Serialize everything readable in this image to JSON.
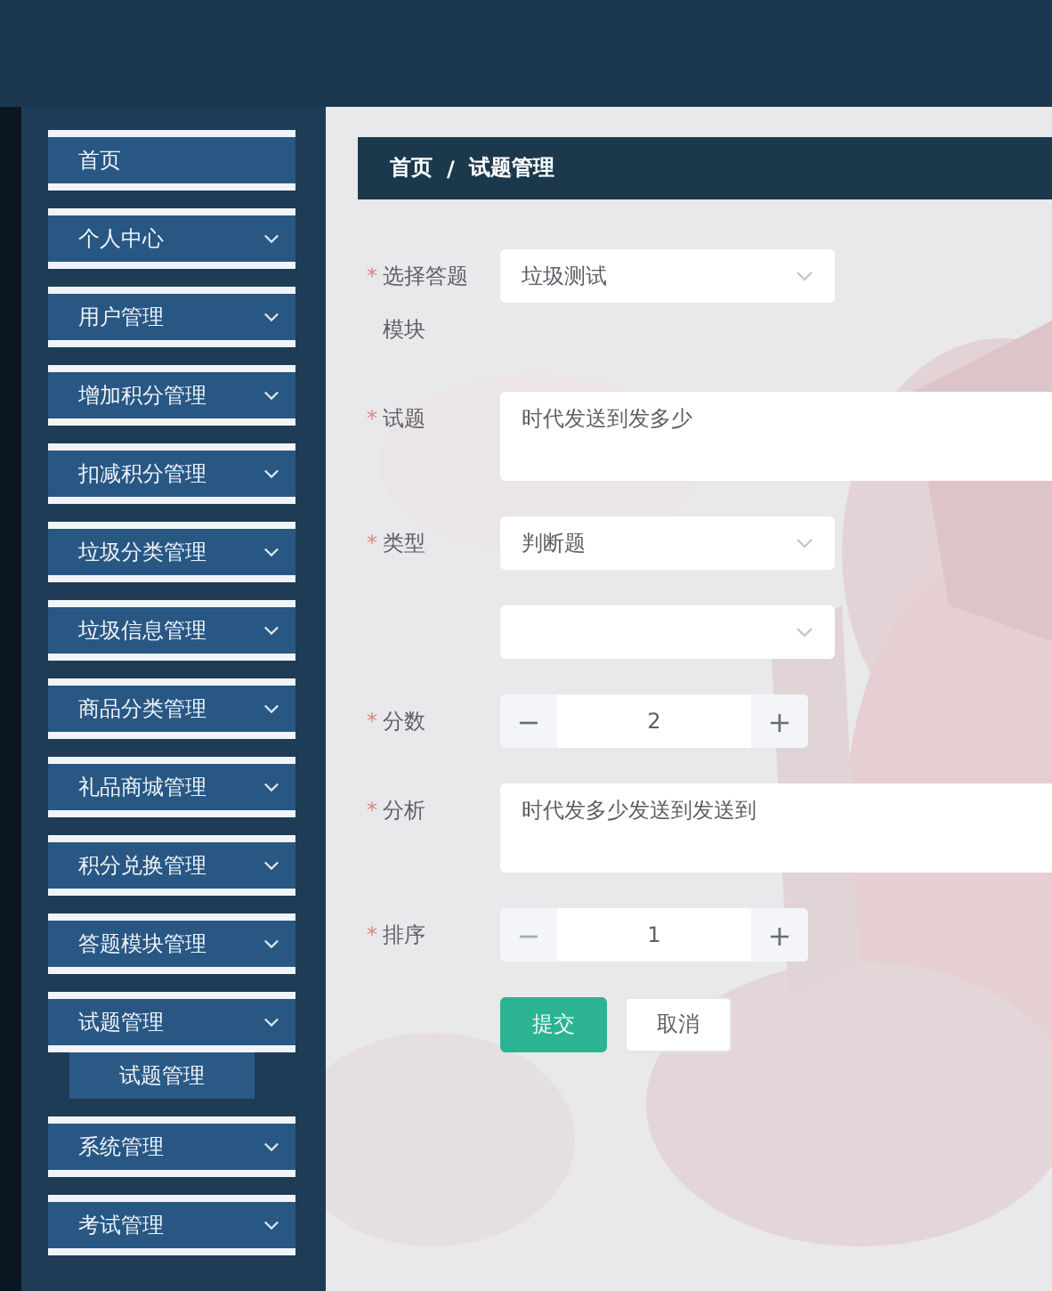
{
  "sidebar": {
    "items": [
      {
        "label": "首页",
        "expandable": false
      },
      {
        "label": "个人中心",
        "expandable": true,
        "expanded": false
      },
      {
        "label": "用户管理",
        "expandable": true,
        "expanded": false
      },
      {
        "label": "增加积分管理",
        "expandable": true,
        "expanded": false
      },
      {
        "label": "扣减积分管理",
        "expandable": true,
        "expanded": false
      },
      {
        "label": "垃圾分类管理",
        "expandable": true,
        "expanded": false
      },
      {
        "label": "垃圾信息管理",
        "expandable": true,
        "expanded": false
      },
      {
        "label": "商品分类管理",
        "expandable": true,
        "expanded": false
      },
      {
        "label": "礼品商城管理",
        "expandable": true,
        "expanded": false
      },
      {
        "label": "积分兑换管理",
        "expandable": true,
        "expanded": false
      },
      {
        "label": "答题模块管理",
        "expandable": true,
        "expanded": false
      },
      {
        "label": "试题管理",
        "expandable": true,
        "expanded": true,
        "children": [
          {
            "label": "试题管理"
          }
        ]
      },
      {
        "label": "系统管理",
        "expandable": true,
        "expanded": false
      },
      {
        "label": "考试管理",
        "expandable": true,
        "expanded": false
      }
    ]
  },
  "breadcrumb": {
    "separator": "/",
    "items": [
      {
        "label": "首页"
      },
      {
        "label": "试题管理"
      }
    ]
  },
  "form": {
    "fields": [
      {
        "kind": "select",
        "label": "选择答题模块",
        "required_mark": "*",
        "value": "垃圾测试"
      },
      {
        "kind": "textarea",
        "label": "试题",
        "required_mark": "*",
        "value": "时代发送到发多少"
      },
      {
        "kind": "select",
        "label": "类型",
        "required_mark": "*",
        "value": "判断题"
      },
      {
        "kind": "select"
      },
      {
        "kind": "number",
        "label": "分数",
        "required_mark": "*",
        "value": "2",
        "decrease": "−",
        "increase": "+",
        "decrease_disabled": false
      },
      {
        "kind": "textarea",
        "label": "分析",
        "required_mark": "*",
        "value": "时代发多少发送到发送到"
      },
      {
        "kind": "number",
        "label": "排序",
        "required_mark": "*",
        "value": "1",
        "decrease": "−",
        "increase": "+",
        "decrease_disabled": true
      }
    ],
    "buttons": [
      {
        "label": "提交",
        "kind": "primary"
      },
      {
        "label": "取消",
        "kind": "default"
      }
    ]
  }
}
